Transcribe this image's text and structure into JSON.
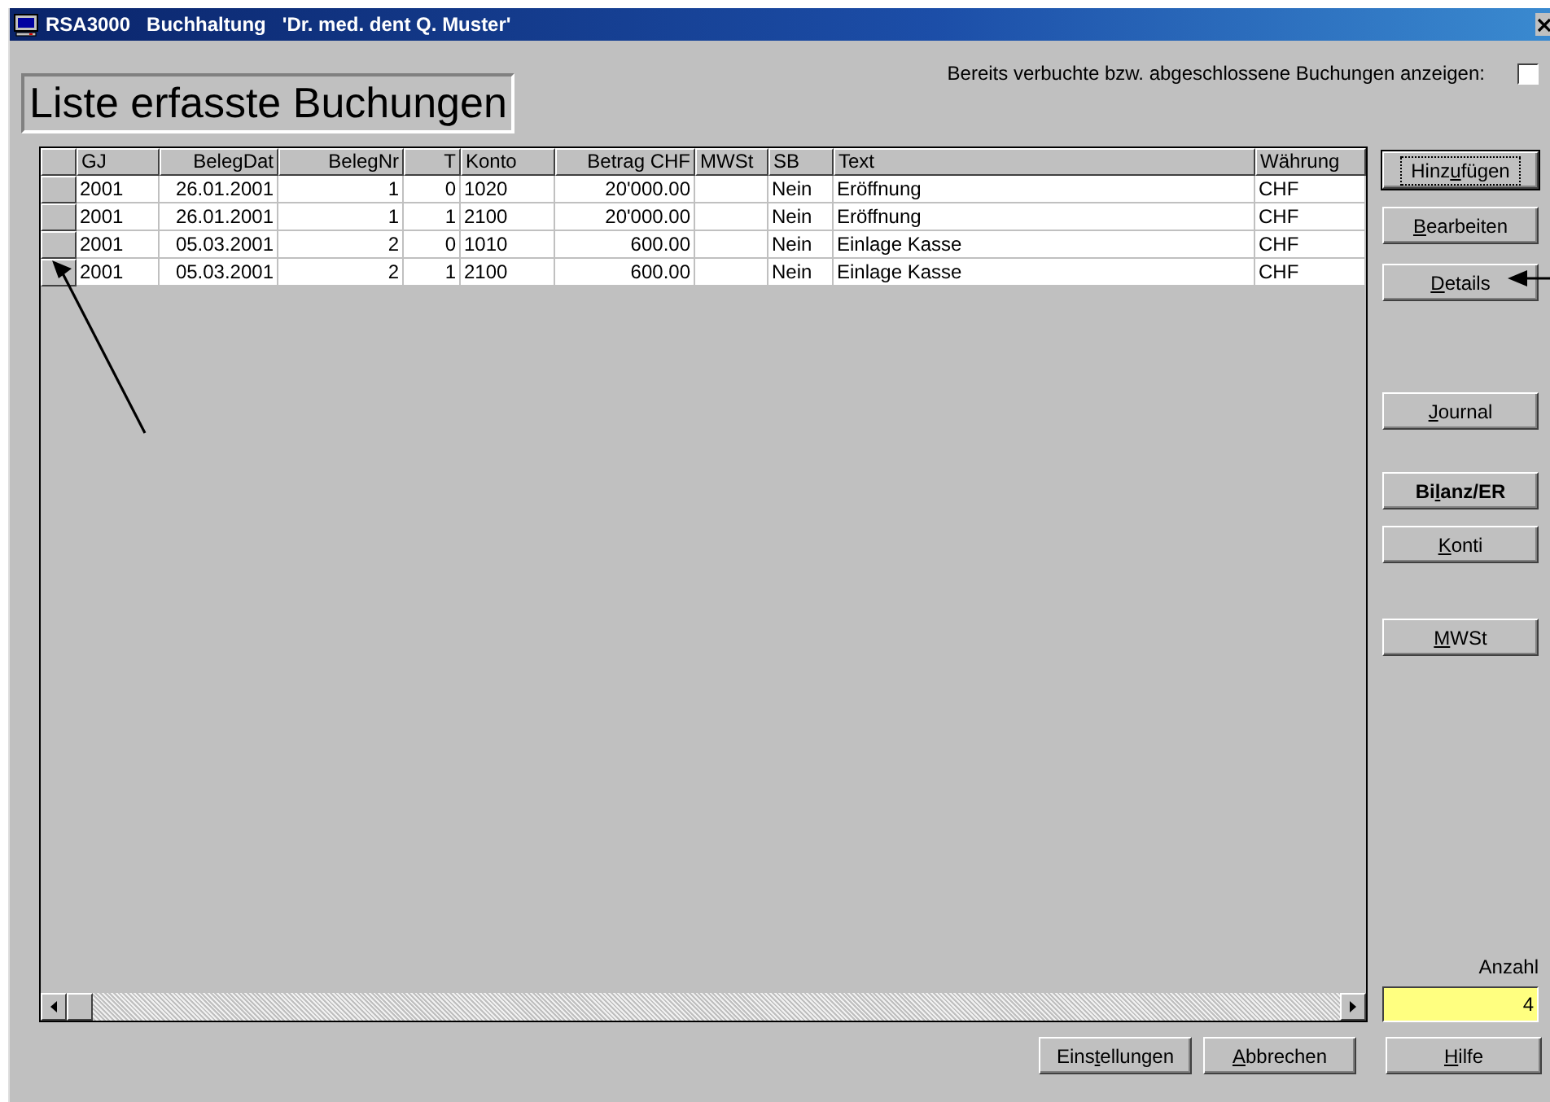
{
  "window": {
    "title": "RSA3000   Buchhaltung   'Dr. med. dent Q. Muster'"
  },
  "heading": "Liste erfasste Buchungen",
  "show_booked": {
    "label": "Bereits verbuchte bzw. abgeschlossene Buchungen anzeigen:",
    "checked": false
  },
  "table": {
    "columns": [
      "GJ",
      "BelegDat",
      "BelegNr",
      "T",
      "Konto",
      "Betrag CHF",
      "MWSt",
      "SB",
      "Text",
      "Währung"
    ],
    "rows": [
      [
        "2001",
        "26.01.2001",
        "1",
        "0",
        "1020",
        "20'000.00",
        "",
        "Nein",
        "Eröffnung",
        "CHF"
      ],
      [
        "2001",
        "26.01.2001",
        "1",
        "1",
        "2100",
        "20'000.00",
        "",
        "Nein",
        "Eröffnung",
        "CHF"
      ],
      [
        "2001",
        "05.03.2001",
        "2",
        "0",
        "1010",
        "600.00",
        "",
        "Nein",
        "Einlage Kasse",
        "CHF"
      ],
      [
        "2001",
        "05.03.2001",
        "2",
        "1",
        "2100",
        "600.00",
        "",
        "Nein",
        "Einlage Kasse",
        "CHF"
      ]
    ]
  },
  "side_buttons": [
    {
      "label": "Hinzufügen",
      "bold": false,
      "focused": true
    },
    {
      "label": "Bearbeiten",
      "bold": false,
      "focused": false
    },
    {
      "label": "Details",
      "bold": false,
      "focused": false
    },
    {
      "label": "Journal",
      "bold": false,
      "focused": false
    },
    {
      "label": "Bilanz/ER",
      "bold": true,
      "focused": false
    },
    {
      "label": "Konti",
      "bold": false,
      "focused": false
    },
    {
      "label": "MWSt",
      "bold": false,
      "focused": false
    }
  ],
  "count": {
    "label": "Anzahl",
    "value": "4"
  },
  "bottom_buttons": [
    "Einstellungen",
    "Abbrechen",
    "Hilfe"
  ]
}
